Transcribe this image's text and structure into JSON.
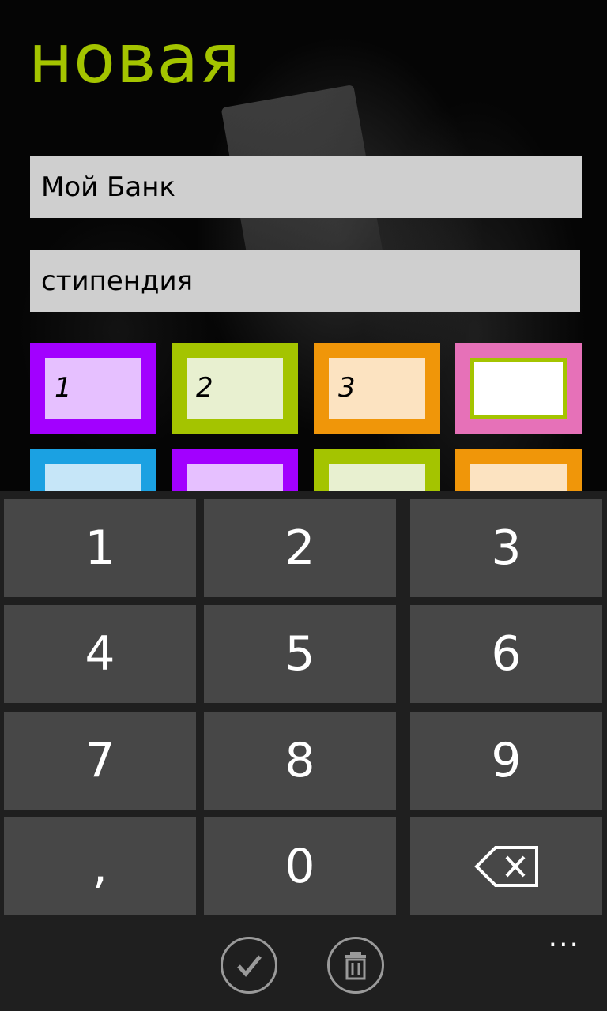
{
  "page": {
    "title": "новая"
  },
  "form": {
    "bank_name": "Мой Банк",
    "description": "стипендия"
  },
  "tiles": [
    {
      "label": "1",
      "border": "#a200ff",
      "fill": "#e6c0ff"
    },
    {
      "label": "2",
      "border": "#a4c400",
      "fill": "#e8f0d0"
    },
    {
      "label": "3",
      "border": "#f09609",
      "fill": "#fce3c1"
    },
    {
      "label": "",
      "border": "#e671b8",
      "fill": "#ffffff",
      "inner_border": "#a4c400"
    },
    {
      "label": "",
      "border": "#1ba1e2",
      "fill": "#c6e6f8"
    },
    {
      "label": "",
      "border": "#a200ff",
      "fill": "#e6c0ff"
    },
    {
      "label": "",
      "border": "#a4c400",
      "fill": "#e8f0d0"
    },
    {
      "label": "",
      "border": "#f09609",
      "fill": "#fce3c1"
    }
  ],
  "keypad": {
    "keys": [
      "1",
      "2",
      "3",
      "4",
      "5",
      "6",
      "7",
      "8",
      "9",
      ",",
      "0",
      "backspace"
    ]
  },
  "appbar": {
    "buttons": [
      {
        "icon": "check-icon"
      },
      {
        "icon": "trash-icon"
      }
    ],
    "more": "..."
  },
  "colors": {
    "accent": "#a4c400",
    "field_bg": "#cfcfcf",
    "key_bg": "#474747",
    "keypad_bg": "#1f1f1f"
  }
}
